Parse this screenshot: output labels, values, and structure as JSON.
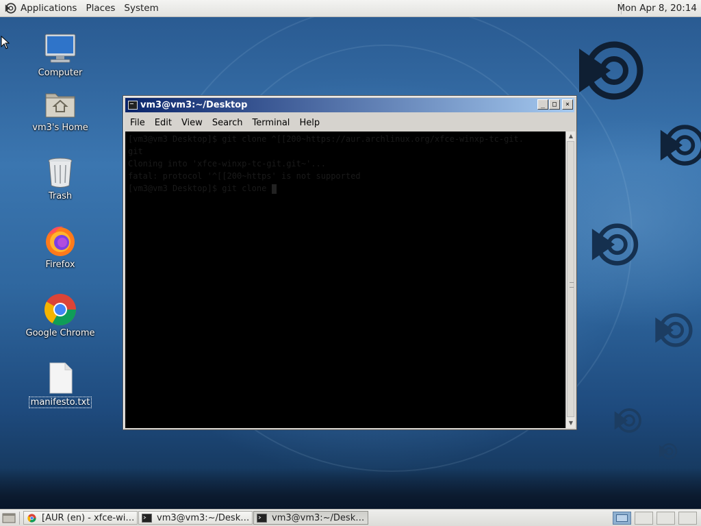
{
  "top_panel": {
    "menus": [
      "Applications",
      "Places",
      "System"
    ],
    "clock": "Mon Apr  8, 20:14"
  },
  "desktop_icons": [
    {
      "label": "Computer",
      "icon": "computer-icon"
    },
    {
      "label": "vm3's Home",
      "icon": "home-folder-icon"
    },
    {
      "label": "Trash",
      "icon": "trash-icon"
    },
    {
      "label": "Firefox",
      "icon": "firefox-icon"
    },
    {
      "label": "Google Chrome",
      "icon": "chrome-icon"
    },
    {
      "label": "manifesto.txt",
      "icon": "text-file-icon"
    }
  ],
  "terminal_window": {
    "title": "vm3@vm3:~/Desktop",
    "menus": [
      "File",
      "Edit",
      "View",
      "Search",
      "Terminal",
      "Help"
    ],
    "lines": [
      "[vm3@vm3 Desktop]$ git clone ^[[200~https://aur.archlinux.org/xfce-winxp-tc-git.",
      "git",
      "Cloning into 'xfce-winxp-tc-git.git~'...",
      "fatal: protocol '^[[200~https' is not supported",
      "[vm3@vm3 Desktop]$ git clone "
    ]
  },
  "taskbar": {
    "tasks": [
      {
        "label": "[AUR (en) - xfce-win...",
        "icon": "chrome-icon",
        "active": false
      },
      {
        "label": "vm3@vm3:~/Desktop",
        "icon": "terminal-icon",
        "active": false
      },
      {
        "label": "vm3@vm3:~/Desktop",
        "icon": "terminal-icon",
        "active": true
      }
    ],
    "workspaces": 4,
    "current_workspace": 1
  },
  "colors": {
    "titlebar_start": "#0a246a",
    "titlebar_end": "#a6caf0",
    "desktop_blue": "#2f679f",
    "terminal_bg": "#000000"
  }
}
